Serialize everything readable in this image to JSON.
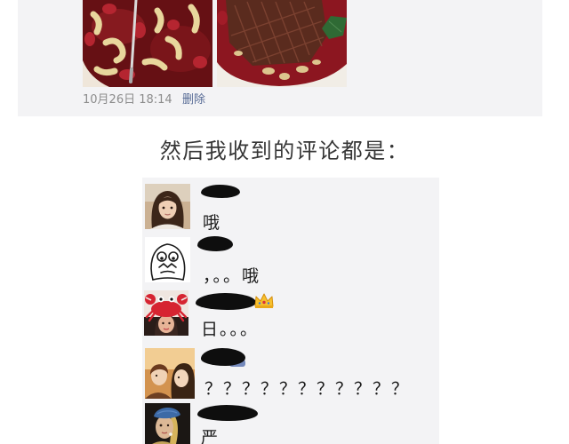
{
  "post": {
    "timestamp": "10月26日 18:14",
    "delete_label": "删除",
    "photos": [
      {
        "icon": "red-dish-photo-icon"
      },
      {
        "icon": "chocolate-cake-photo-icon"
      }
    ]
  },
  "caption": "然后我收到的评论都是：",
  "comments": [
    {
      "avatar_icon": "girl-portrait-avatar-icon",
      "text": "哦"
    },
    {
      "avatar_icon": "line-drawing-face-avatar-icon",
      "text": "，。。哦"
    },
    {
      "avatar_icon": "crab-hat-avatar-icon",
      "badge_icon": "crown-icon",
      "text": "日。。。"
    },
    {
      "avatar_icon": "couple-photo-avatar-icon",
      "text": "？？？？？？？？？？？"
    },
    {
      "avatar_icon": "pearl-earring-avatar-icon",
      "text": "严"
    }
  ],
  "colors": {
    "page_background": "#ffffff",
    "card_background": "#f3f3f5",
    "link": "#576b95",
    "timestamp": "#8c8c8c",
    "redaction": "#0e0e0e"
  }
}
